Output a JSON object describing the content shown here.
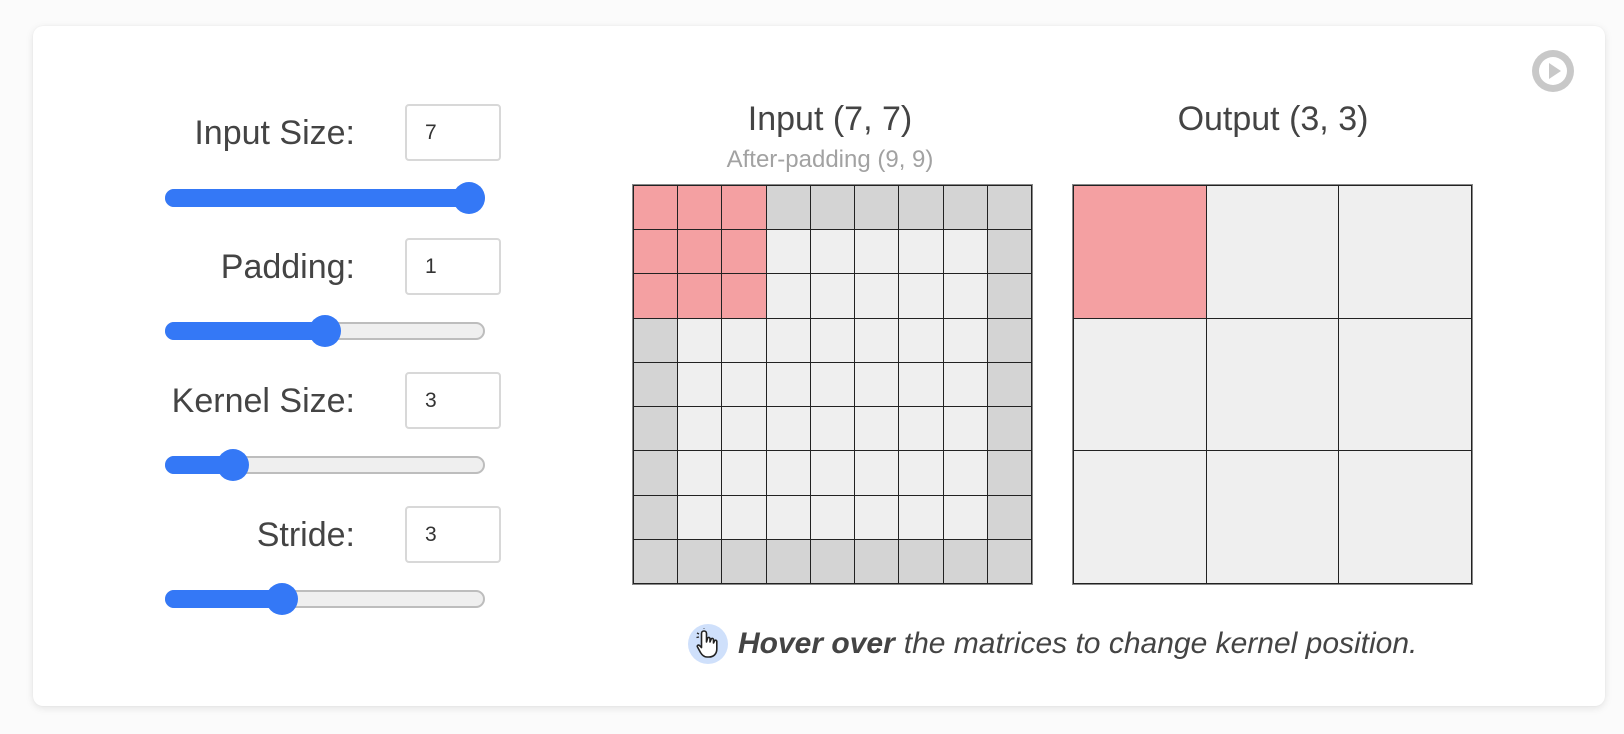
{
  "controls": {
    "input_size": {
      "label": "Input Size:",
      "value": "7",
      "slider_fraction": 1.0
    },
    "padding": {
      "label": "Padding:",
      "value": "1",
      "slider_fraction": 0.5
    },
    "kernel_size": {
      "label": "Kernel Size:",
      "value": "3",
      "slider_fraction": 0.18
    },
    "stride": {
      "label": "Stride:",
      "value": "3",
      "slider_fraction": 0.35
    }
  },
  "input_matrix": {
    "title": "Input (7, 7)",
    "subtitle": "After-padding (9, 9)",
    "size": 9,
    "padding": 1,
    "kernel_size": 3,
    "kernel_row": 0,
    "kernel_col": 0
  },
  "output_matrix": {
    "title": "Output (3, 3)",
    "size": 3,
    "highlight_row": 0,
    "highlight_col": 0
  },
  "hint": {
    "bold": "Hover over",
    "rest": "the matrices to change kernel position.",
    "icon": "pointer-hand-icon"
  },
  "play_button": {
    "icon": "play-icon"
  },
  "colors": {
    "accent": "#3478f6",
    "kernel": "#f4a0a2",
    "padding_cell": "#d4d4d4",
    "cell": "#efefef"
  }
}
